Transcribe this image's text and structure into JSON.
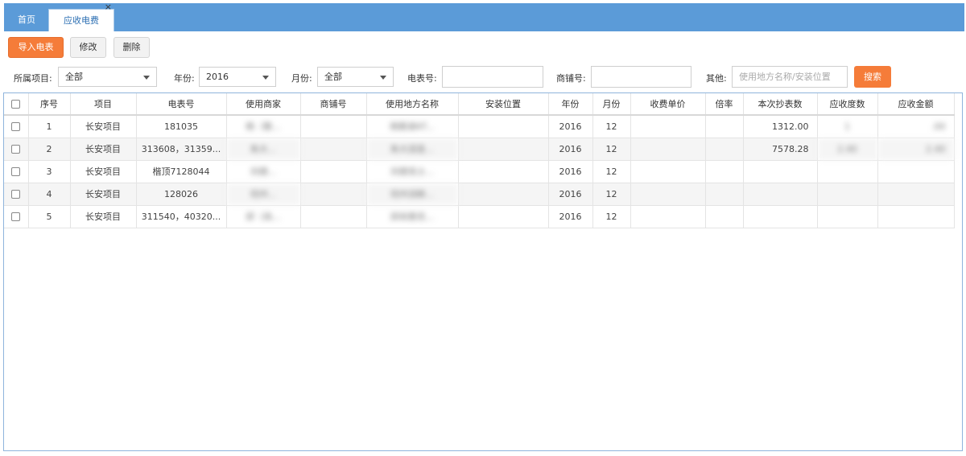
{
  "tabs": {
    "home": "首页",
    "active": "应收电费",
    "close": "×"
  },
  "toolbar": {
    "import": "导入电表",
    "edit": "修改",
    "delete": "删除"
  },
  "filters": {
    "project_label": "所属项目:",
    "project_value": "全部",
    "year_label": "年份:",
    "year_value": "2016",
    "month_label": "月份:",
    "month_value": "全部",
    "meter_label": "电表号:",
    "meter_value": "",
    "shop_label": "商铺号:",
    "shop_value": "",
    "other_label": "其他:",
    "other_placeholder": "使用地方名称/安装位置",
    "search": "搜索"
  },
  "table": {
    "headers": [
      "序号",
      "项目",
      "电表号",
      "使用商家",
      "商铺号",
      "使用地方名称",
      "安装位置",
      "年份",
      "月份",
      "收费单价",
      "倍率",
      "本次抄表数",
      "应收度数",
      "应收金额"
    ],
    "rows": [
      {
        "no": "1",
        "project": "长安项目",
        "meter": "181035",
        "merchant": "杨（歌...",
        "shop": "",
        "place": "杨歌弟KT...",
        "location": "",
        "year": "2016",
        "month": "12",
        "price": "",
        "rate": "",
        "reading": "1312.00",
        "degrees": "1",
        "amount": ".00"
      },
      {
        "no": "2",
        "project": "长安项目",
        "meter": "313608，31359...",
        "merchant": "朱大...",
        "shop": "",
        "place": "朱大润发...",
        "location": "",
        "year": "2016",
        "month": "12",
        "price": "",
        "rate": "",
        "reading": "7578.28",
        "degrees": "2.40",
        "amount": "2.40"
      },
      {
        "no": "3",
        "project": "长安项目",
        "meter": "楷顶7128044",
        "merchant": "刘德...",
        "shop": "",
        "place": "刘德克士...",
        "location": "",
        "year": "2016",
        "month": "12",
        "price": "",
        "rate": "",
        "reading": "",
        "degrees": "",
        "amount": ""
      },
      {
        "no": "4",
        "project": "长安项目",
        "meter": "128026",
        "merchant": "何州...",
        "shop": "",
        "place": "何州派斡...",
        "location": "",
        "year": "2016",
        "month": "12",
        "price": "",
        "rate": "",
        "reading": "",
        "degrees": "",
        "amount": ""
      },
      {
        "no": "5",
        "project": "长安项目",
        "meter": "311540，40320...",
        "merchant": "邱（尚...",
        "shop": "",
        "place": "邱尚客优...",
        "location": "",
        "year": "2016",
        "month": "12",
        "price": "",
        "rate": "",
        "reading": "",
        "degrees": "",
        "amount": ""
      }
    ]
  },
  "icons": {
    "dropdown": "chevron-down-icon",
    "checkbox": "checkbox-icon",
    "close": "close-icon"
  },
  "colors": {
    "header_bar": "#5b9bd8",
    "accent_orange": "#f57c39",
    "grid_border": "#8fb4dc"
  }
}
